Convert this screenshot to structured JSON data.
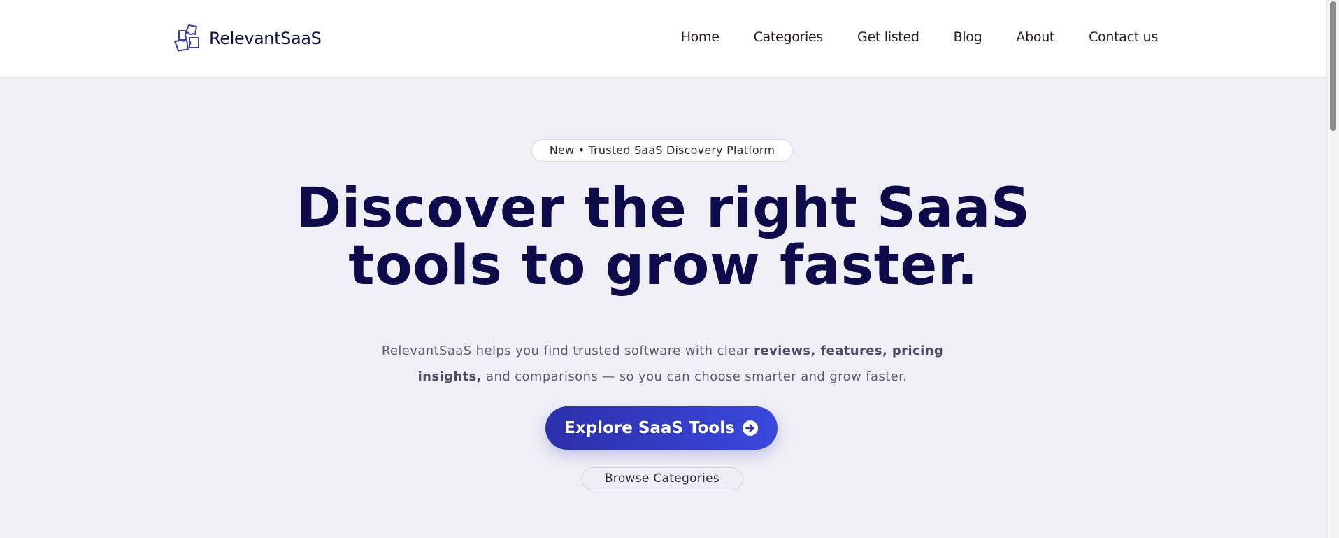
{
  "brand": {
    "name": "RelevantSaaS",
    "logo_icon": "puzzle-squares-icon"
  },
  "nav": {
    "items": [
      {
        "label": "Home"
      },
      {
        "label": "Categories"
      },
      {
        "label": "Get listed"
      },
      {
        "label": "Blog"
      },
      {
        "label": "About"
      },
      {
        "label": "Contact us"
      }
    ]
  },
  "hero": {
    "badge": "New • Trusted SaaS Discovery Platform",
    "headline_line1": "Discover the right SaaS",
    "headline_line2": "tools to grow faster.",
    "subtext_prefix": "RelevantSaaS helps you find trusted software with clear ",
    "subtext_bold": "reviews, features, pricing insights,",
    "subtext_suffix": " and comparisons — so you can choose smarter and grow faster.",
    "cta_label": "Explore SaaS Tools",
    "cta_icon": "arrow-circle-right-icon",
    "secondary_label": "Browse Categories"
  },
  "colors": {
    "background": "#f1eff6",
    "headline": "#0d0b4a",
    "cta_gradient_start": "#2c2fa8",
    "cta_gradient_end": "#3a48de",
    "logo": "#3b3fa0"
  }
}
